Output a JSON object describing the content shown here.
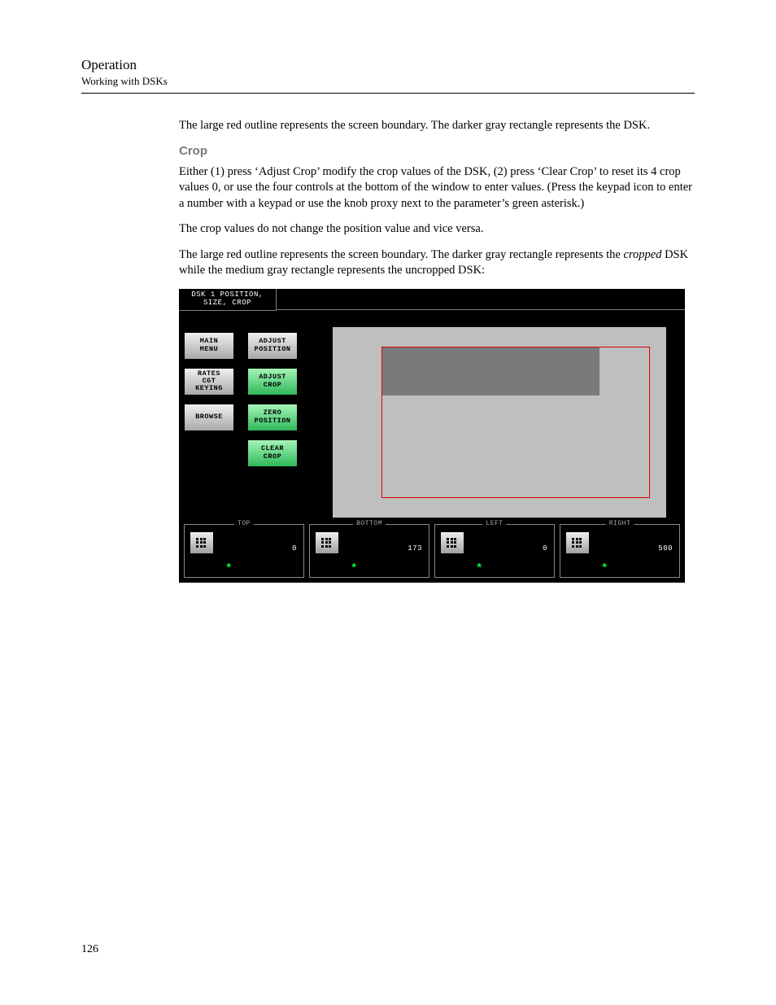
{
  "header": {
    "title": "Operation",
    "subtitle": "Working with DSKs"
  },
  "paragraphs": {
    "p1": "The large red outline represents the screen boundary. The darker gray rectangle represents the DSK.",
    "crop_heading": "Crop",
    "p2": "Either (1) press ‘Adjust Crop’ modify the crop values of the DSK, (2) press ‘Clear Crop’ to reset its 4 crop values 0, or use the four controls at the bottom of the window to enter values. (Press the keypad icon to enter a number with a keypad or use the knob proxy next to the parameter’s green asterisk.)",
    "p3": "The crop values do not change the position value and vice versa.",
    "p4a": "The large red outline represents the screen boundary. The darker gray rectangle represents the ",
    "p4b": "cropped",
    "p4c": " DSK while the medium gray rectangle represents the uncropped DSK:"
  },
  "panel": {
    "tab_line1": "DSK 1 POSITION,",
    "tab_line2": "SIZE, CROP",
    "left_buttons": {
      "main_menu": "MAIN\nMENU",
      "rates": "RATES\nCGT\nKEYING",
      "browse": "BROWSE"
    },
    "right_buttons": {
      "adjust_position": "ADJUST\nPOSITION",
      "adjust_crop": "ADJUST\nCROP",
      "zero_position": "ZERO\nPOSITION",
      "clear_crop": "CLEAR\nCROP"
    },
    "controls": {
      "top": {
        "label": "TOP",
        "value": "0"
      },
      "bottom": {
        "label": "BOTTOM",
        "value": "173"
      },
      "left": {
        "label": "LEFT",
        "value": "0"
      },
      "right": {
        "label": "RIGHT",
        "value": "500"
      }
    }
  },
  "page_number": "126"
}
